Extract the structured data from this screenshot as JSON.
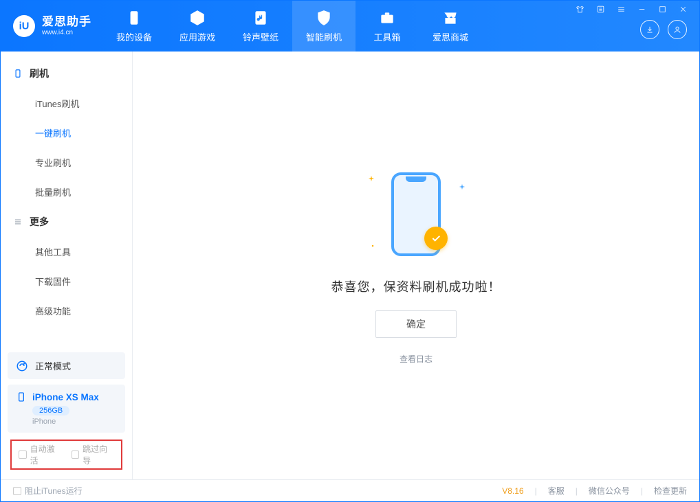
{
  "brand": {
    "name": "爱思助手",
    "url": "www.i4.cn"
  },
  "nav": {
    "tabs": [
      {
        "label": "我的设备"
      },
      {
        "label": "应用游戏"
      },
      {
        "label": "铃声壁纸"
      },
      {
        "label": "智能刷机"
      },
      {
        "label": "工具箱"
      },
      {
        "label": "爱思商城"
      }
    ]
  },
  "sidebar": {
    "group1": {
      "title": "刷机",
      "items": [
        {
          "label": "iTunes刷机"
        },
        {
          "label": "一键刷机"
        },
        {
          "label": "专业刷机"
        },
        {
          "label": "批量刷机"
        }
      ]
    },
    "group2": {
      "title": "更多",
      "items": [
        {
          "label": "其他工具"
        },
        {
          "label": "下载固件"
        },
        {
          "label": "高级功能"
        }
      ]
    },
    "mode_card": {
      "label": "正常模式"
    },
    "device": {
      "name": "iPhone XS Max",
      "storage": "256GB",
      "type": "iPhone"
    },
    "checks": {
      "auto_activate": "自动激活",
      "skip_guide": "跳过向导"
    }
  },
  "main": {
    "success_text": "恭喜您，保资料刷机成功啦！",
    "ok_label": "确定",
    "logs_label": "查看日志"
  },
  "statusbar": {
    "block_itunes": "阻止iTunes运行",
    "version": "V8.16",
    "support": "客服",
    "wechat": "微信公众号",
    "update": "检查更新"
  }
}
